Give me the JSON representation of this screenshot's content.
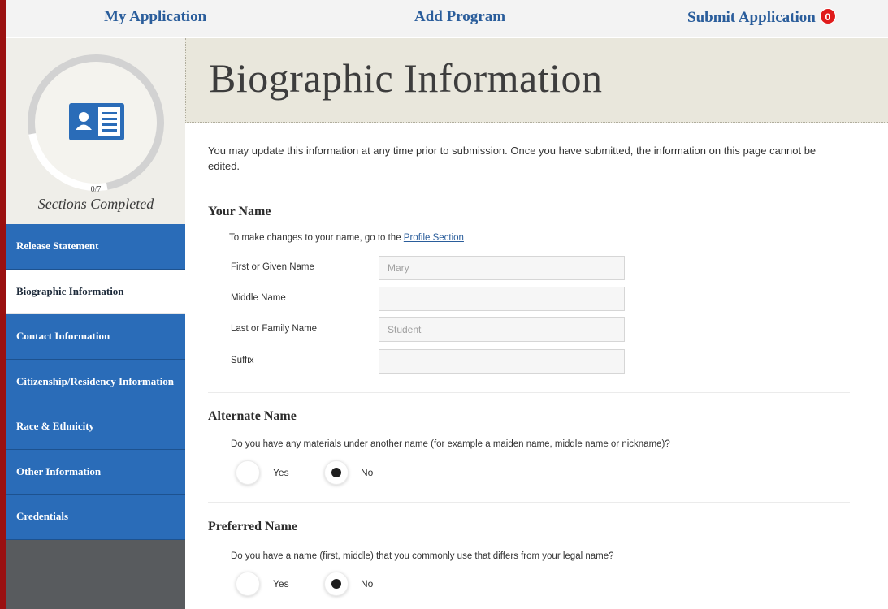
{
  "nav": {
    "my_application": "My Application",
    "add_program": "Add Program",
    "submit_application": "Submit Application",
    "submit_count": "0"
  },
  "progress": {
    "count": "0/7",
    "label": "Sections Completed",
    "icon": "id-card-icon"
  },
  "sidebar": {
    "items": [
      {
        "label": "Release Statement"
      },
      {
        "label": "Biographic Information"
      },
      {
        "label": "Contact Information"
      },
      {
        "label": "Citizenship/Residency Information"
      },
      {
        "label": "Race & Ethnicity"
      },
      {
        "label": "Other Information"
      },
      {
        "label": "Credentials"
      }
    ],
    "active_index": 1
  },
  "page": {
    "title": "Biographic Information",
    "intro": "You may update this information at any time prior to submission. Once you have submitted, the information on this page cannot be edited."
  },
  "your_name": {
    "heading": "Your Name",
    "note_prefix": "To make changes to your name, go to the ",
    "note_link": "Profile Section",
    "fields": [
      {
        "label": "First or Given Name",
        "value": "Mary"
      },
      {
        "label": "Middle Name",
        "value": ""
      },
      {
        "label": "Last or Family Name",
        "value": "Student"
      },
      {
        "label": "Suffix",
        "value": ""
      }
    ]
  },
  "alternate_name": {
    "heading": "Alternate Name",
    "question": "Do you have any materials under another name (for example a maiden name, middle name or nickname)?",
    "yes": "Yes",
    "no": "No",
    "selected": "No"
  },
  "preferred_name": {
    "heading": "Preferred Name",
    "question": "Do you have a name (first, middle) that you commonly use that differs from your legal name?",
    "yes": "Yes",
    "no": "No",
    "selected": "No"
  },
  "colors": {
    "frame": "#9a1010",
    "sidebar_blue": "#2a6cb8",
    "link_blue": "#2a5d9b",
    "badge_red": "#e01b1b",
    "hero_bg": "#e9e7dc"
  }
}
